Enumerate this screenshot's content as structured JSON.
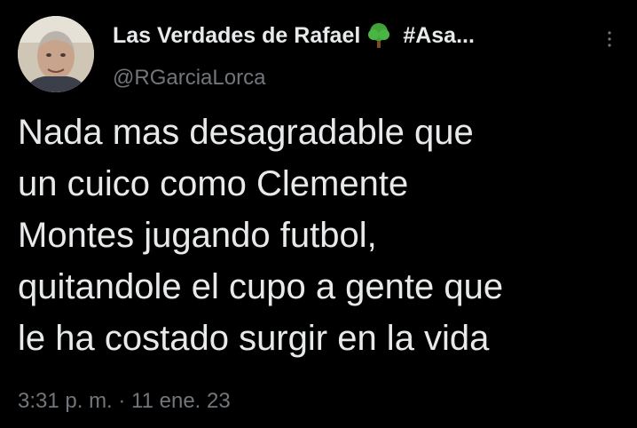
{
  "author": {
    "display_name": "Las Verdades de Rafael",
    "display_name_suffix": "#Asa...",
    "handle": "@RGarciaLorca",
    "emoji_icon": "deciduous-tree-icon",
    "avatar": "profile-photo"
  },
  "tweet": {
    "lines": [
      "Nada mas desagradable que",
      "un cuico como Clemente",
      "Montes jugando futbol,",
      "quitandole el cupo a gente que",
      "le ha costado surgir en la vida"
    ],
    "timestamp": "3:31 p. m. · 11 ene. 23"
  },
  "colors": {
    "background": "#000000",
    "primary_text": "#e7e9ea",
    "secondary_text": "#71767b"
  },
  "icons": {
    "more": "more-options-icon"
  }
}
